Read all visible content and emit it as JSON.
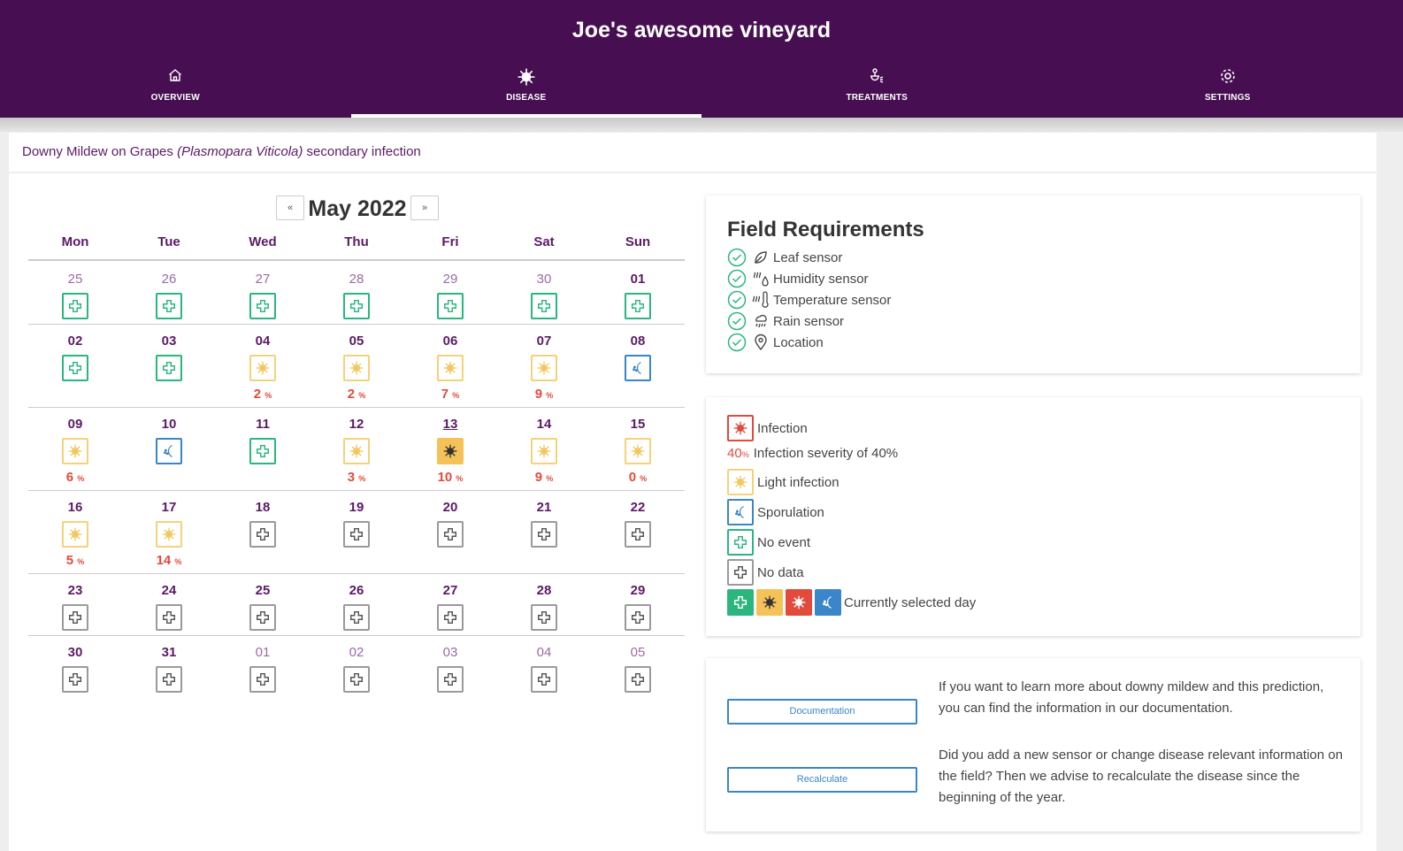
{
  "app": {
    "title": "Joe's awesome vineyard"
  },
  "nav": [
    {
      "label": "OVERVIEW",
      "icon": "home-icon"
    },
    {
      "label": "DISEASE",
      "icon": "virus-icon",
      "active": true
    },
    {
      "label": "TREATMENTS",
      "icon": "sprayer-icon"
    },
    {
      "label": "SETTINGS",
      "icon": "gear-icon"
    }
  ],
  "disease": {
    "prefix": "Downy Mildew on Grapes ",
    "latin": "(Plasmopara Viticola)",
    "suffix": " secondary infection"
  },
  "calendar": {
    "month_label": "May 2022",
    "prev_label": "«",
    "next_label": "»",
    "days_of_week": [
      "Mon",
      "Tue",
      "Wed",
      "Thu",
      "Fri",
      "Sat",
      "Sun"
    ],
    "weeks": [
      [
        {
          "num": "25",
          "other": true,
          "type": "noevent"
        },
        {
          "num": "26",
          "other": true,
          "type": "noevent"
        },
        {
          "num": "27",
          "other": true,
          "type": "noevent"
        },
        {
          "num": "28",
          "other": true,
          "type": "noevent"
        },
        {
          "num": "29",
          "other": true,
          "type": "noevent"
        },
        {
          "num": "30",
          "other": true,
          "type": "noevent"
        },
        {
          "num": "01",
          "type": "noevent"
        }
      ],
      [
        {
          "num": "02",
          "type": "noevent"
        },
        {
          "num": "03",
          "type": "noevent"
        },
        {
          "num": "04",
          "type": "light",
          "sev": "2"
        },
        {
          "num": "05",
          "type": "light",
          "sev": "2"
        },
        {
          "num": "06",
          "type": "light",
          "sev": "7"
        },
        {
          "num": "07",
          "type": "light",
          "sev": "9"
        },
        {
          "num": "08",
          "type": "spor"
        }
      ],
      [
        {
          "num": "09",
          "type": "light",
          "sev": "6"
        },
        {
          "num": "10",
          "type": "spor"
        },
        {
          "num": "11",
          "type": "noevent"
        },
        {
          "num": "12",
          "type": "light",
          "sev": "3"
        },
        {
          "num": "13",
          "type": "light",
          "sev": "10",
          "selected": true,
          "today": true
        },
        {
          "num": "14",
          "type": "light",
          "sev": "9"
        },
        {
          "num": "15",
          "type": "light",
          "sev": "0"
        }
      ],
      [
        {
          "num": "16",
          "type": "light",
          "sev": "5"
        },
        {
          "num": "17",
          "type": "light",
          "sev": "14"
        },
        {
          "num": "18",
          "type": "nodata"
        },
        {
          "num": "19",
          "type": "nodata"
        },
        {
          "num": "20",
          "type": "nodata"
        },
        {
          "num": "21",
          "type": "nodata"
        },
        {
          "num": "22",
          "type": "nodata"
        }
      ],
      [
        {
          "num": "23",
          "type": "nodata"
        },
        {
          "num": "24",
          "type": "nodata"
        },
        {
          "num": "25",
          "type": "nodata"
        },
        {
          "num": "26",
          "type": "nodata"
        },
        {
          "num": "27",
          "type": "nodata"
        },
        {
          "num": "28",
          "type": "nodata"
        },
        {
          "num": "29",
          "type": "nodata"
        }
      ],
      [
        {
          "num": "30",
          "type": "nodata"
        },
        {
          "num": "31",
          "type": "nodata"
        },
        {
          "num": "01",
          "other": true,
          "type": "nodata"
        },
        {
          "num": "02",
          "other": true,
          "type": "nodata"
        },
        {
          "num": "03",
          "other": true,
          "type": "nodata"
        },
        {
          "num": "04",
          "other": true,
          "type": "nodata"
        },
        {
          "num": "05",
          "other": true,
          "type": "nodata"
        }
      ]
    ],
    "percent_symbol": "%"
  },
  "field_requirements": {
    "title": "Field Requirements",
    "items": [
      {
        "label": "Leaf sensor",
        "icon": "leaf-icon"
      },
      {
        "label": "Humidity sensor",
        "icon": "humidity-icon"
      },
      {
        "label": "Temperature sensor",
        "icon": "thermometer-icon"
      },
      {
        "label": "Rain sensor",
        "icon": "rain-icon"
      },
      {
        "label": "Location",
        "icon": "location-pin-icon"
      }
    ]
  },
  "legend": {
    "infection": "Infection",
    "severity_sample": "40",
    "severity_text": "Infection severity of 40%",
    "light": "Light infection",
    "sporulation": "Sporulation",
    "no_event": "No event",
    "no_data": "No data",
    "selected": "Currently selected day"
  },
  "actions": {
    "documentation_label": "Documentation",
    "documentation_text": "If you want to learn more about downy mildew and this prediction, you can find the information in our documentation.",
    "recalculate_label": "Recalculate",
    "recalculate_text": "Did you add a new sensor or change disease relevant information on the field? Then we advise to recalculate the disease since the beginning of the year."
  },
  "colors": {
    "header": "#470f52",
    "accent_text": "#5b1a66",
    "no_event": "#2bb67e",
    "light_infection": "#f5c25a",
    "infection": "#e24a3b",
    "sporulation": "#3a86c8"
  }
}
